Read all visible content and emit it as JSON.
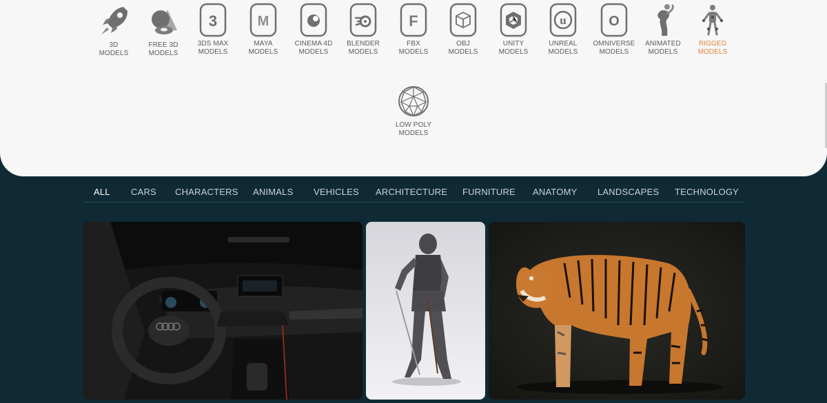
{
  "formats": [
    {
      "line1": "3D",
      "line2": "MODELS",
      "icon": "rocket-icon"
    },
    {
      "line1": "FREE 3D",
      "line2": "MODELS",
      "icon": "free-shapes-icon"
    },
    {
      "line1": "3DS MAX",
      "line2": "MODELS",
      "icon": "3dsmax-icon",
      "glyph": "3"
    },
    {
      "line1": "MAYA",
      "line2": "MODELS",
      "icon": "maya-icon",
      "glyph": "M"
    },
    {
      "line1": "CINEMA 4D",
      "line2": "MODELS",
      "icon": "cinema4d-icon"
    },
    {
      "line1": "BLENDER",
      "line2": "MODELS",
      "icon": "blender-icon"
    },
    {
      "line1": "FBX",
      "line2": "MODELS",
      "icon": "fbx-icon",
      "glyph": "F"
    },
    {
      "line1": "OBJ",
      "line2": "MODELS",
      "icon": "obj-cube-icon"
    },
    {
      "line1": "UNITY",
      "line2": "MODELS",
      "icon": "unity-icon"
    },
    {
      "line1": "UNREAL",
      "line2": "MODELS",
      "icon": "unreal-icon",
      "glyph": "u"
    },
    {
      "line1": "OMNIVERSE",
      "line2": "MODELS",
      "icon": "omniverse-icon",
      "glyph": "O"
    },
    {
      "line1": "ANIMATED",
      "line2": "MODELS",
      "icon": "animated-figure-icon"
    },
    {
      "line1": "RIGGED",
      "line2": "MODELS",
      "icon": "rigged-skeleton-icon",
      "active": true
    },
    {
      "line1": "LOW POLY",
      "line2": "MODELS",
      "icon": "low-poly-sphere-icon"
    }
  ],
  "categories": [
    "ALL",
    "CARS",
    "CHARACTERS",
    "ANIMALS",
    "VEHICLES",
    "ARCHITECTURE",
    "FURNITURE",
    "ANATOMY",
    "LANDSCAPES",
    "TECHNOLOGY"
  ],
  "active_category": "ALL",
  "cards": [
    {
      "subject": "car-interior-thumbnail"
    },
    {
      "subject": "knight-armor-thumbnail"
    },
    {
      "subject": "tiger-thumbnail"
    }
  ],
  "colors": {
    "accent": "#e8803a",
    "panel": "#f7f7f7",
    "background": "#0f2a35",
    "icon_gray": "#6f6f6f"
  }
}
